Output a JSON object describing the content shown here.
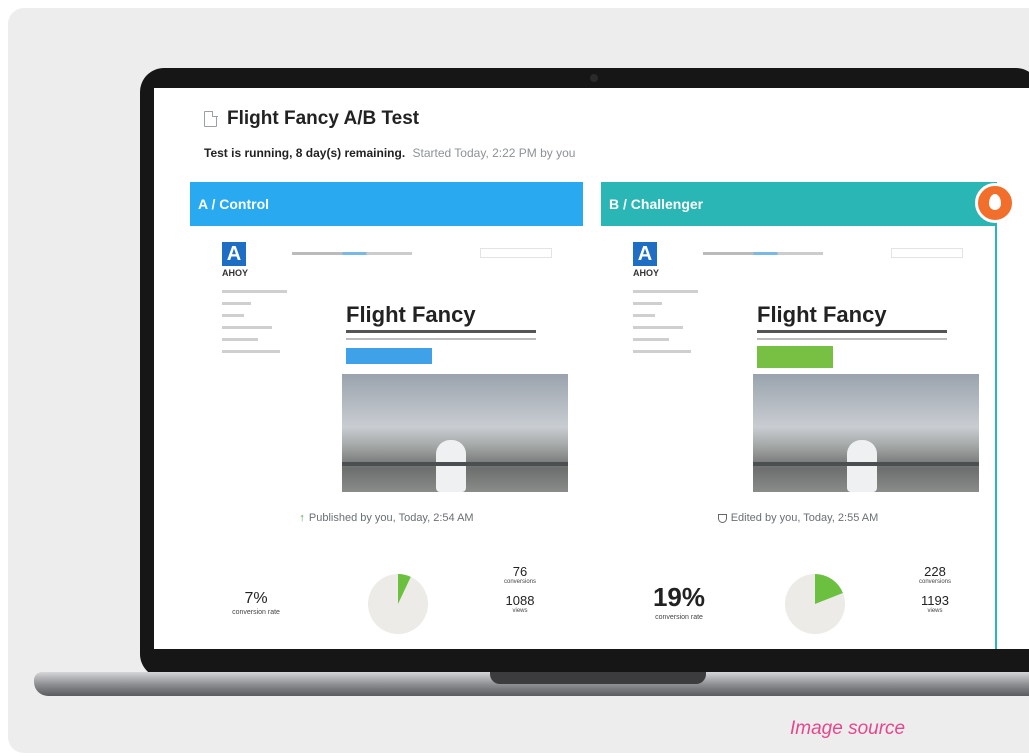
{
  "test": {
    "title": "Flight Fancy A/B Test",
    "status_bold": "Test is running, 8 day(s) remaining.",
    "started": "Started Today, 2:22 PM by you"
  },
  "variants": [
    {
      "name": "A / Control",
      "color": "#28a9f0",
      "preview": {
        "logo_letter": "A",
        "logo_text": "AHOY",
        "hero_title": "Flight Fancy"
      },
      "published": "Published by you, Today, 2:54 AM",
      "conversion_rate": "7%",
      "conversion_rate_label": "conversion rate",
      "conversion_fraction": 0.07,
      "conversions": "76",
      "conversions_label": "conversions",
      "views": "1088",
      "views_label": "views"
    },
    {
      "name": "B / Challenger",
      "color": "#29b6b4",
      "preview": {
        "logo_letter": "A",
        "logo_text": "AHOY",
        "hero_title": "Flight Fancy"
      },
      "published": "Edited by you, Today, 2:55 AM",
      "conversion_rate": "19%",
      "conversion_rate_label": "conversion rate",
      "conversion_fraction": 0.19,
      "conversions": "228",
      "conversions_label": "conversions",
      "views": "1193",
      "views_label": "views"
    }
  ],
  "winner_icon": "flame-icon",
  "caption": "Image source",
  "colors": {
    "accent_green": "#6cc040",
    "caption": "#e5478e",
    "pie_bg": "#ecebe8"
  }
}
